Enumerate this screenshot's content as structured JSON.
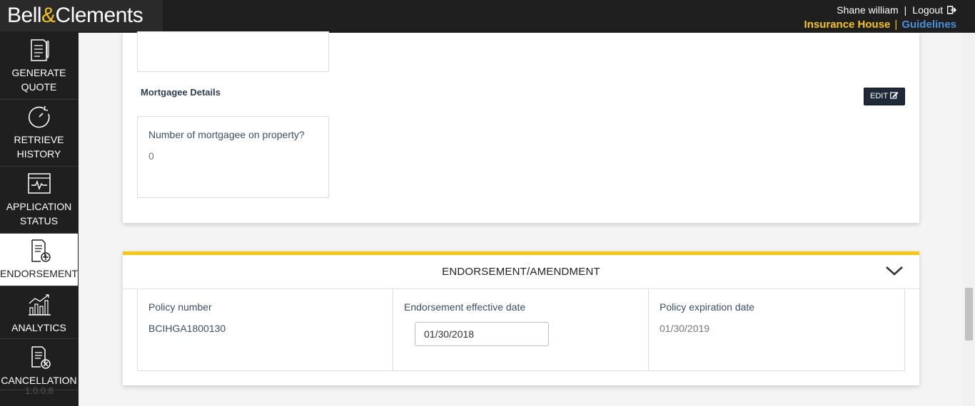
{
  "header": {
    "logo_left": "Bell",
    "logo_amp": "&",
    "logo_right": "Clements",
    "user_name": "Shane william",
    "separator": "|",
    "logout": "Logout",
    "insurance_house": "Insurance House",
    "guidelines": "Guidelines"
  },
  "sidebar": {
    "items": [
      {
        "line1": "GENERATE",
        "line2": "QUOTE"
      },
      {
        "line1": "RETRIEVE",
        "line2": "HISTORY"
      },
      {
        "line1": "APPLICATION",
        "line2": "STATUS"
      },
      {
        "line1": "ENDORSEMENT",
        "line2": ""
      },
      {
        "line1": "ANALYTICS",
        "line2": ""
      },
      {
        "line1": "CANCELLATION",
        "line2": ""
      }
    ],
    "version": "1.0.0.8"
  },
  "mortgagee": {
    "title": "Mortgagee Details",
    "edit_label": "EDIT",
    "question": "Number of mortgagee on property?",
    "answer": "0"
  },
  "endorsement": {
    "title": "ENDORSEMENT/AMENDMENT",
    "policy_number_label": "Policy number",
    "policy_number": "BCIHGA1800130",
    "effective_date_label": "Endorsement effective date",
    "effective_date": "01/30/2018",
    "expiration_label": "Policy expiration date",
    "expiration_date": "01/30/2019"
  },
  "colors": {
    "accent_yellow": "#f5c518",
    "link_blue": "#4a90d9",
    "dark_bg": "#1f1f1f"
  }
}
